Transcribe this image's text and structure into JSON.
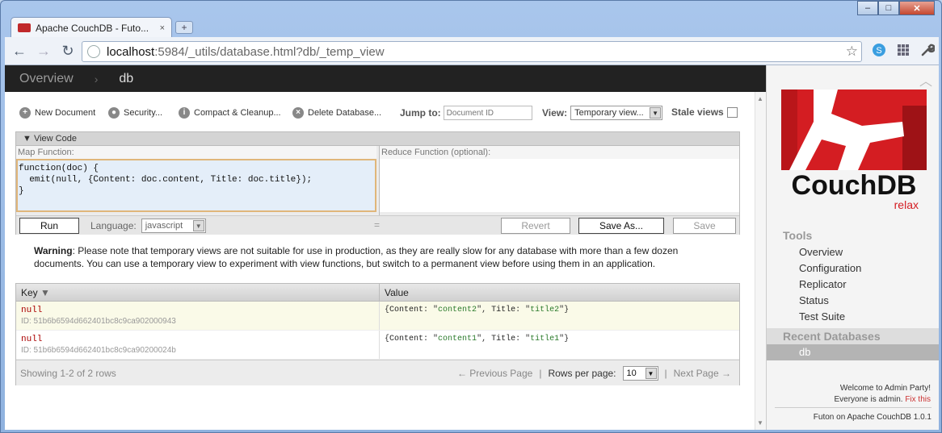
{
  "browser": {
    "tab_title": "Apache CouchDB - Futo...",
    "tab_close": "×",
    "new_tab": "+",
    "url_host": "localhost",
    "url_path": ":5984/_utils/database.html?db/_temp_view",
    "win_min": "–",
    "win_max": "□",
    "win_close": "✕"
  },
  "breadcrumb": {
    "home": "Overview",
    "separator": "›",
    "current": "db"
  },
  "actions": {
    "new_document": "New Document",
    "security": "Security...",
    "compact": "Compact & Cleanup...",
    "delete": "Delete Database...",
    "jump_label": "Jump to:",
    "jump_placeholder": "Document ID",
    "view_label": "View:",
    "view_value": "Temporary view...",
    "stale_label": "Stale views"
  },
  "view_code": {
    "header": "▼ View Code",
    "map_label": "Map Function:",
    "reduce_label": "Reduce Function (optional):",
    "map_code": "function(doc) {\n  emit(null, {Content: doc.content, Title: doc.title});\n}",
    "run": "Run",
    "language_label": "Language:",
    "language_value": "javascript",
    "grip": "=",
    "revert": "Revert",
    "save_as": "Save As...",
    "save": "Save"
  },
  "warning": {
    "label": "Warning",
    "text": ": Please note that temporary views are not suitable for use in production, as they are really slow for any database with more than a few dozen documents. You can use a temporary view to experiment with view functions, but switch to a permanent view before using them in an application."
  },
  "results": {
    "col_key": "Key",
    "col_value": "Value",
    "rows": [
      {
        "key": "null",
        "id": "ID: 51b6b6594d662401bc8c9ca902000943",
        "content": "content2",
        "title": "title2"
      },
      {
        "key": "null",
        "id": "ID: 51b6b6594d662401bc8c9ca90200024b",
        "content": "content1",
        "title": "title1"
      }
    ],
    "showing": "Showing 1-2 of 2 rows",
    "prev": "← Previous Page",
    "rpp_label": "Rows per page:",
    "rpp_value": "10",
    "next": "Next Page →",
    "divider": "|"
  },
  "sidebar": {
    "logo_text": "CouchDB",
    "logo_sub": "relax",
    "tools_header": "Tools",
    "tools": [
      "Overview",
      "Configuration",
      "Replicator",
      "Status",
      "Test Suite"
    ],
    "recent_header": "Recent Databases",
    "recent": [
      "db"
    ],
    "welcome_line1": "Welcome to Admin Party!",
    "welcome_line2": "Everyone is admin.",
    "fix_this": "Fix this",
    "footer": "Futon on Apache CouchDB 1.0.1"
  },
  "colors": {
    "couch_red": "#d41d22",
    "topbar": "#222222",
    "warn_border": "#e0b67a"
  }
}
